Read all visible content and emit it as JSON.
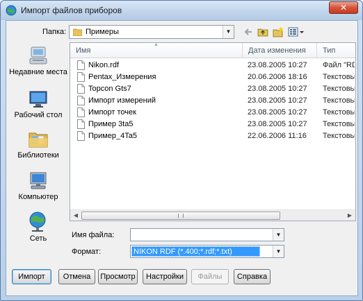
{
  "window": {
    "title": "Импорт файлов приборов",
    "close_glyph": "✕"
  },
  "toolbar": {
    "folder_label": "Папка:",
    "folder_value": "Примеры",
    "icons": [
      "back-arrow-icon",
      "up-folder-icon",
      "new-folder-icon",
      "view-menu-icon"
    ]
  },
  "places": [
    {
      "label": "Недавние места",
      "icon": "recent-places-icon"
    },
    {
      "label": "Рабочий стол",
      "icon": "desktop-icon"
    },
    {
      "label": "Библиотеки",
      "icon": "libraries-icon"
    },
    {
      "label": "Компьютер",
      "icon": "computer-icon"
    },
    {
      "label": "Сеть",
      "icon": "network-icon"
    }
  ],
  "list": {
    "columns": [
      "Имя",
      "Дата изменения",
      "Тип"
    ],
    "rows": [
      {
        "name": "Nikon.rdf",
        "date": "23.08.2005 10:27",
        "type": "Файл \"RD"
      },
      {
        "name": "Pentax_Измерения",
        "date": "20.06.2006 18:16",
        "type": "Текстовы"
      },
      {
        "name": "Topcon Gts7",
        "date": "23.08.2005 10:27",
        "type": "Текстовы"
      },
      {
        "name": "Импорт измерений",
        "date": "23.08.2005 10:27",
        "type": "Текстовы"
      },
      {
        "name": "Импорт точек",
        "date": "23.08.2005 10:27",
        "type": "Текстовы"
      },
      {
        "name": "Пример 3ta5",
        "date": "23.08.2005 10:27",
        "type": "Текстовы"
      },
      {
        "name": "Пример_4Ta5",
        "date": "22.06.2006 11:16",
        "type": "Текстовы"
      }
    ]
  },
  "form": {
    "filename_label": "Имя файла:",
    "filename_value": "",
    "format_label": "Формат:",
    "format_value": "NIKON RDF (*.400;*.rdf;*.txt)"
  },
  "buttons": {
    "import": "Импорт",
    "cancel": "Отмена",
    "preview": "Просмотр",
    "settings": "Настройки",
    "files": "Файлы",
    "help": "Справка"
  },
  "colors": {
    "selection": "#3399ff",
    "close_button": "#c53c22"
  }
}
